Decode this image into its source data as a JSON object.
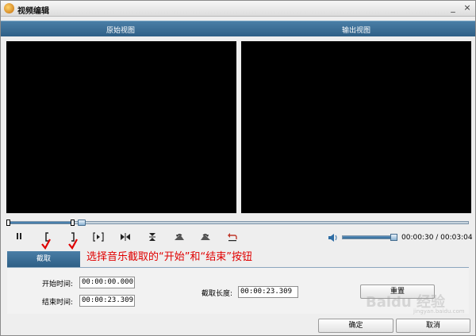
{
  "window": {
    "title": "视频编辑",
    "minimize_glyph": "_",
    "close_glyph": "×"
  },
  "header": {
    "original_view": "原始视图",
    "output_view": "输出视图"
  },
  "timeline": {
    "progress": 0.16,
    "start_marker": 0.0,
    "end_marker": 0.14
  },
  "controls": {
    "pause_icon": "pause-icon",
    "mark_start_icon": "bracket-left-icon",
    "mark_end_icon": "bracket-right-icon",
    "play_selection_icon": "play-selection-icon",
    "goto_start_icon": "goto-marker-icon",
    "middle_icon": "split-icon",
    "rotate_left_icon": "rotate-left-icon",
    "rotate_right_icon": "rotate-right-icon",
    "undo_icon": "undo-icon"
  },
  "volume": {
    "level": 0.98,
    "icon": "speaker-icon"
  },
  "time_readout": "00:00:30 / 00:03:04",
  "tab": {
    "label": "截取"
  },
  "annotation": "选择音乐截取的“开始”和“结束”按钮",
  "form": {
    "start_label": "开始时间:",
    "start_value": "00:00:00.000",
    "end_label": "结束时间:",
    "end_value": "00:00:23.309",
    "length_label": "截取长度:",
    "length_value": "00:00:23.309",
    "reset_label": "重置"
  },
  "footer": {
    "ok_label": "确定",
    "cancel_label": "取消"
  },
  "watermark": {
    "text": "Baidu 经验",
    "sub": "jingyan.baidu.com"
  },
  "colors": {
    "accent": "#2e5f86",
    "annotation": "#e00000",
    "check": "#e00000"
  }
}
